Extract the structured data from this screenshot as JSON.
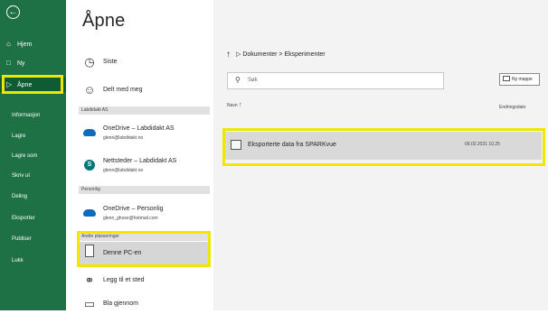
{
  "nav": {
    "back_icon": "back-arrow-icon",
    "items": [
      {
        "label": "Hjem",
        "icon": "home-icon"
      },
      {
        "label": "Ny",
        "icon": "new-document-icon"
      },
      {
        "label": "Åpne",
        "icon": "open-folder-icon"
      }
    ],
    "sub_items": [
      "Informasjon",
      "Lagre",
      "Lagre som",
      "Skriv ut",
      "Deling",
      "Eksporter",
      "Publiser",
      "Lukk"
    ]
  },
  "page": {
    "title": "Åpne"
  },
  "locations": {
    "recent": "Siste",
    "shared": "Delt med meg",
    "section_labdidakt": "Labdidakt AS",
    "onedrive_org": {
      "name": "OneDrive – Labdidakt AS",
      "email": "glenn@labdidakt.no"
    },
    "sharepoint": {
      "name": "Nettsteder – Labdidakt AS",
      "email": "glenn@labdidakt.no"
    },
    "section_personal": "Personlig",
    "onedrive_personal": {
      "name": "OneDrive – Personlig",
      "email": "glenn_ghose@hotmail.com"
    },
    "section_other": "Andre plasseringer",
    "this_pc": "Denne PC-en",
    "add_place": "Legg til et sted",
    "browse": "Bla gjennom"
  },
  "browser": {
    "breadcrumb": "Dokumenter > Eksperimenter",
    "search_placeholder": "Søk",
    "new_folder": "Ny mappe",
    "col_name": "Navn",
    "col_date": "Endringsdato",
    "rows": [
      {
        "name": "Eksporterte data fra SPARKvue",
        "date": "09.02.2021 10.25"
      }
    ]
  },
  "colors": {
    "nav_green": "#1e7145",
    "highlight_yellow": "#f2e600",
    "onedrive_blue": "#0f6cbd",
    "sharepoint_teal": "#03787c"
  }
}
